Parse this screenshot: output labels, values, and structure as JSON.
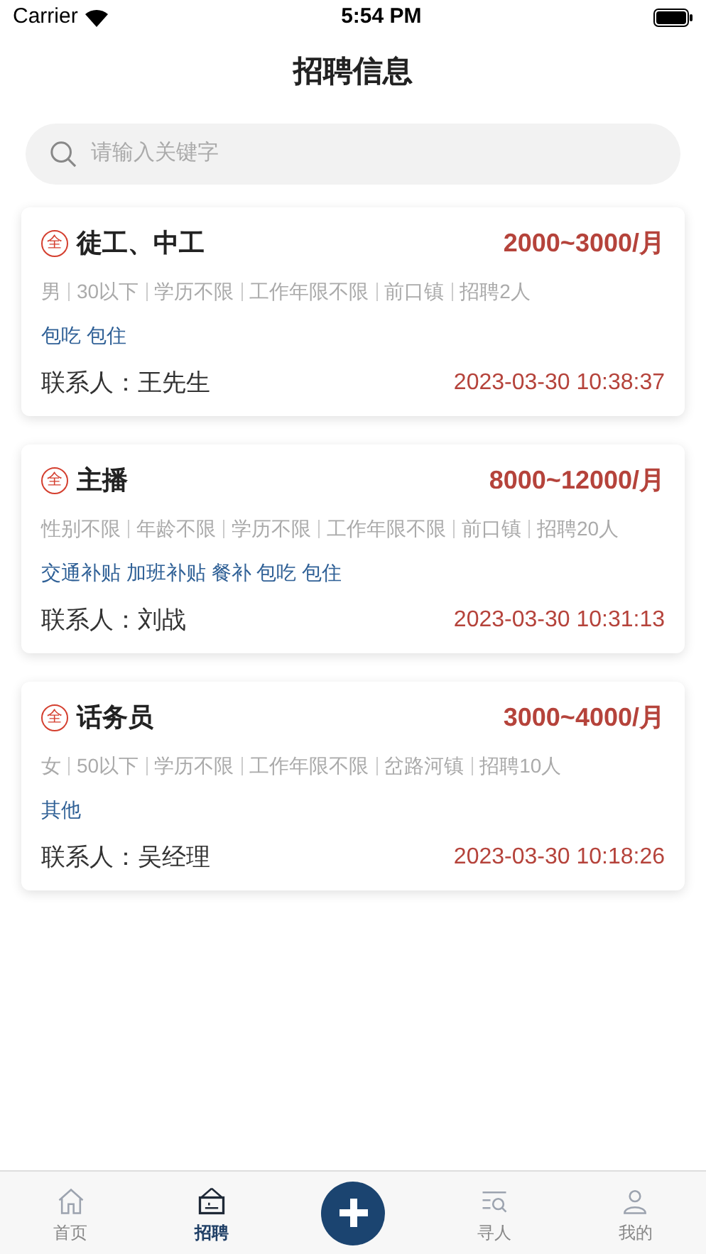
{
  "status_bar": {
    "carrier": "Carrier",
    "time": "5:54 PM"
  },
  "title": "招聘信息",
  "search": {
    "placeholder": "请输入关键字"
  },
  "jobs": [
    {
      "badge": "全",
      "title": "徒工、中工",
      "salary": "2000~3000/月",
      "details": [
        "男",
        "30以下",
        "学历不限",
        "工作年限不限",
        "前口镇",
        "招聘2人"
      ],
      "benefits": "包吃 包住",
      "contact": "联系人：王先生",
      "date": "2023-03-30 10:38:37"
    },
    {
      "badge": "全",
      "title": "主播",
      "salary": "8000~12000/月",
      "details": [
        "性别不限",
        "年龄不限",
        "学历不限",
        "工作年限不限",
        "前口镇",
        "招聘20人"
      ],
      "benefits": "交通补贴 加班补贴 餐补 包吃 包住",
      "contact": "联系人：刘战",
      "date": "2023-03-30 10:31:13"
    },
    {
      "badge": "全",
      "title": "话务员",
      "salary": "3000~4000/月",
      "details": [
        "女",
        "50以下",
        "学历不限",
        "工作年限不限",
        "岔路河镇",
        "招聘10人"
      ],
      "benefits": "其他",
      "contact": "联系人：吴经理",
      "date": "2023-03-30 10:18:26"
    }
  ],
  "tab_bar": [
    {
      "kind": "tab",
      "label": "首页",
      "selected": false
    },
    {
      "kind": "tab",
      "label": "招聘",
      "selected": true
    },
    {
      "kind": "add"
    },
    {
      "kind": "tab",
      "label": "寻人",
      "selected": false
    },
    {
      "kind": "tab",
      "label": "我的",
      "selected": false
    }
  ]
}
